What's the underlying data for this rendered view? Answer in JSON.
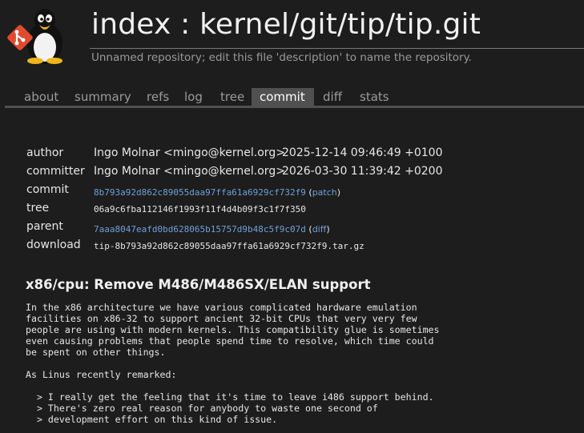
{
  "header": {
    "title": "index : kernel/git/tip/tip.git",
    "description": "Unnamed repository; edit this file 'description' to name the repository."
  },
  "tabs": [
    {
      "label": "about"
    },
    {
      "label": "summary"
    },
    {
      "label": "refs"
    },
    {
      "label": "log"
    },
    {
      "label": "tree"
    },
    {
      "label": "commit",
      "active": true
    },
    {
      "label": "diff"
    },
    {
      "label": "stats"
    }
  ],
  "commit_info": {
    "author_label": "author",
    "author_name": "Ingo Molnar <mingo@kernel.org>",
    "author_date": "2025-12-14 09:46:49 +0100",
    "committer_label": "committer",
    "committer_name": "Ingo Molnar <mingo@kernel.org>",
    "committer_date": "2026-03-30 11:39:42 +0200",
    "commit_label": "commit",
    "commit_hash": "8b793a92d862c89055daa97ffa61a6929cf732f9",
    "patch_link": "patch",
    "tree_label": "tree",
    "tree_hash": "06a9c6fba112146f1993f11f4d4b09f3c1f7f350",
    "parent_label": "parent",
    "parent_hash": "7aaa8047eafd0bd628065b15757d9b48c5f9c07d",
    "diff_link": "diff",
    "download_label": "download",
    "download_file": "tip-8b793a92d862c89055daa97ffa61a6929cf732f9.tar.gz"
  },
  "subject": "x86/cpu: Remove M486/M486SX/ELAN support",
  "message_lines": [
    "In the x86 architecture we have various complicated hardware emulation",
    "facilities on x86-32 to support ancient 32-bit CPUs that very very few",
    "people are using with modern kernels. This compatibility glue is sometimes",
    "even causing problems that people spend time to resolve, which time could",
    "be spent on other things.",
    "",
    "As Linus recently remarked:",
    "",
    "  > I really get the feeling that it's time to leave i486 support behind.",
    "  > There's zero real reason for anybody to waste one second of",
    "  > development effort on this kind of issue."
  ],
  "colors": {
    "background": "#1d1d1d",
    "link": "#6fa0d8",
    "active_tab": "#505050",
    "logo_red": "#e04b2f"
  },
  "icons": {
    "git_logo": "git-logo-icon",
    "tux": "tux-penguin-icon"
  }
}
